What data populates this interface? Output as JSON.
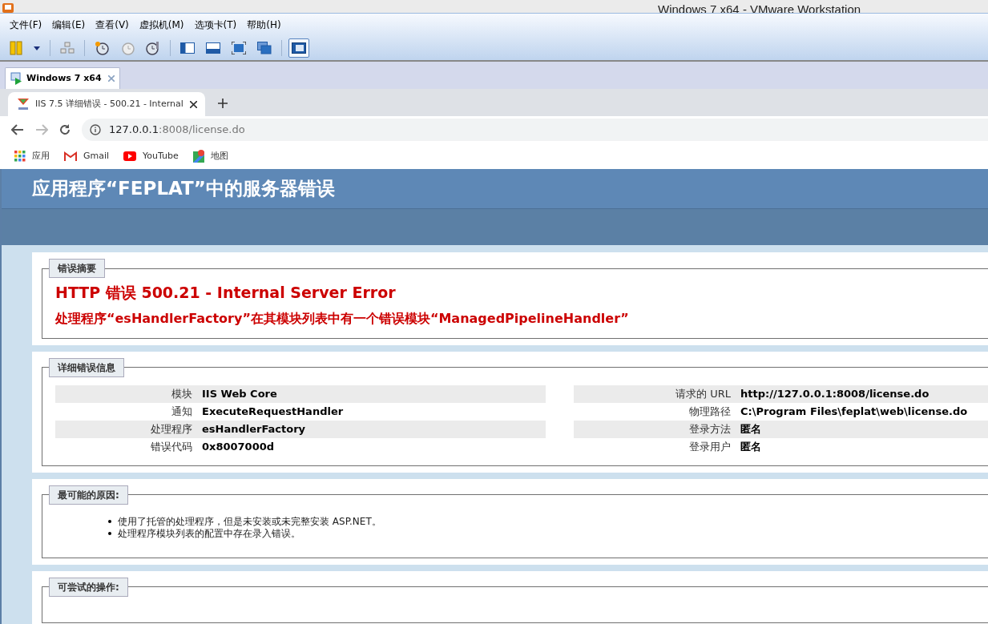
{
  "window": {
    "title": "Windows 7 x64 - VMware Workstation"
  },
  "menu": [
    "文件(F)",
    "编辑(E)",
    "查看(V)",
    "虚拟机(M)",
    "选项卡(T)",
    "帮助(H)"
  ],
  "toolbar": [
    {
      "kind": "pause",
      "selected": false
    },
    {
      "kind": "dropdown",
      "selected": false
    },
    {
      "kind": "sep"
    },
    {
      "kind": "network",
      "selected": false
    },
    {
      "kind": "sep"
    },
    {
      "kind": "snapshot",
      "selected": false
    },
    {
      "kind": "revert",
      "selected": false
    },
    {
      "kind": "manager",
      "selected": false
    },
    {
      "kind": "sep"
    },
    {
      "kind": "sidebar",
      "selected": false
    },
    {
      "kind": "thumbs",
      "selected": false
    },
    {
      "kind": "fullscreen",
      "selected": false
    },
    {
      "kind": "unity",
      "selected": false
    },
    {
      "kind": "sep"
    },
    {
      "kind": "console",
      "selected": true
    }
  ],
  "vm_tabs": [
    {
      "label": "Windows 7 x64",
      "selected": true
    }
  ],
  "browser_tabs": [
    {
      "title": "IIS 7.5 详细错误 - 500.21 - Internal",
      "selected": true
    }
  ],
  "address": {
    "host": "127.0.0.1",
    "rest": ":8008/license.do"
  },
  "bookmarks": [
    {
      "kind": "apps",
      "label": "应用"
    },
    {
      "kind": "gmail",
      "label": "Gmail"
    },
    {
      "kind": "youtube",
      "label": "YouTube"
    },
    {
      "kind": "maps",
      "label": "地图"
    }
  ],
  "page": {
    "title": "应用程序“FEPLAT”中的服务器错误",
    "summary": {
      "legend": "错误摘要",
      "heading": "HTTP 错误 500.21 - Internal Server Error",
      "message": "处理程序“esHandlerFactory”在其模块列表中有一个错误模块“ManagedPipelineHandler”"
    },
    "details": {
      "legend": "详细错误信息",
      "left": [
        {
          "label": "模块",
          "value": "IIS Web Core"
        },
        {
          "label": "通知",
          "value": "ExecuteRequestHandler"
        },
        {
          "label": "处理程序",
          "value": "esHandlerFactory"
        },
        {
          "label": "错误代码",
          "value": "0x8007000d"
        }
      ],
      "right": [
        {
          "label": "请求的 URL",
          "value": "http://127.0.0.1:8008/license.do"
        },
        {
          "label": "物理路径",
          "value": "C:\\Program Files\\feplat\\web\\license.do"
        },
        {
          "label": "登录方法",
          "value": "匿名"
        },
        {
          "label": "登录用户",
          "value": "匿名"
        }
      ]
    },
    "causes": {
      "legend": "最可能的原因:",
      "items": [
        "使用了托管的处理程序，但是未安装或未完整安装 ASP.NET。",
        "处理程序模块列表的配置中存在录入错误。"
      ]
    },
    "actions": {
      "legend": "可尝试的操作:"
    }
  }
}
